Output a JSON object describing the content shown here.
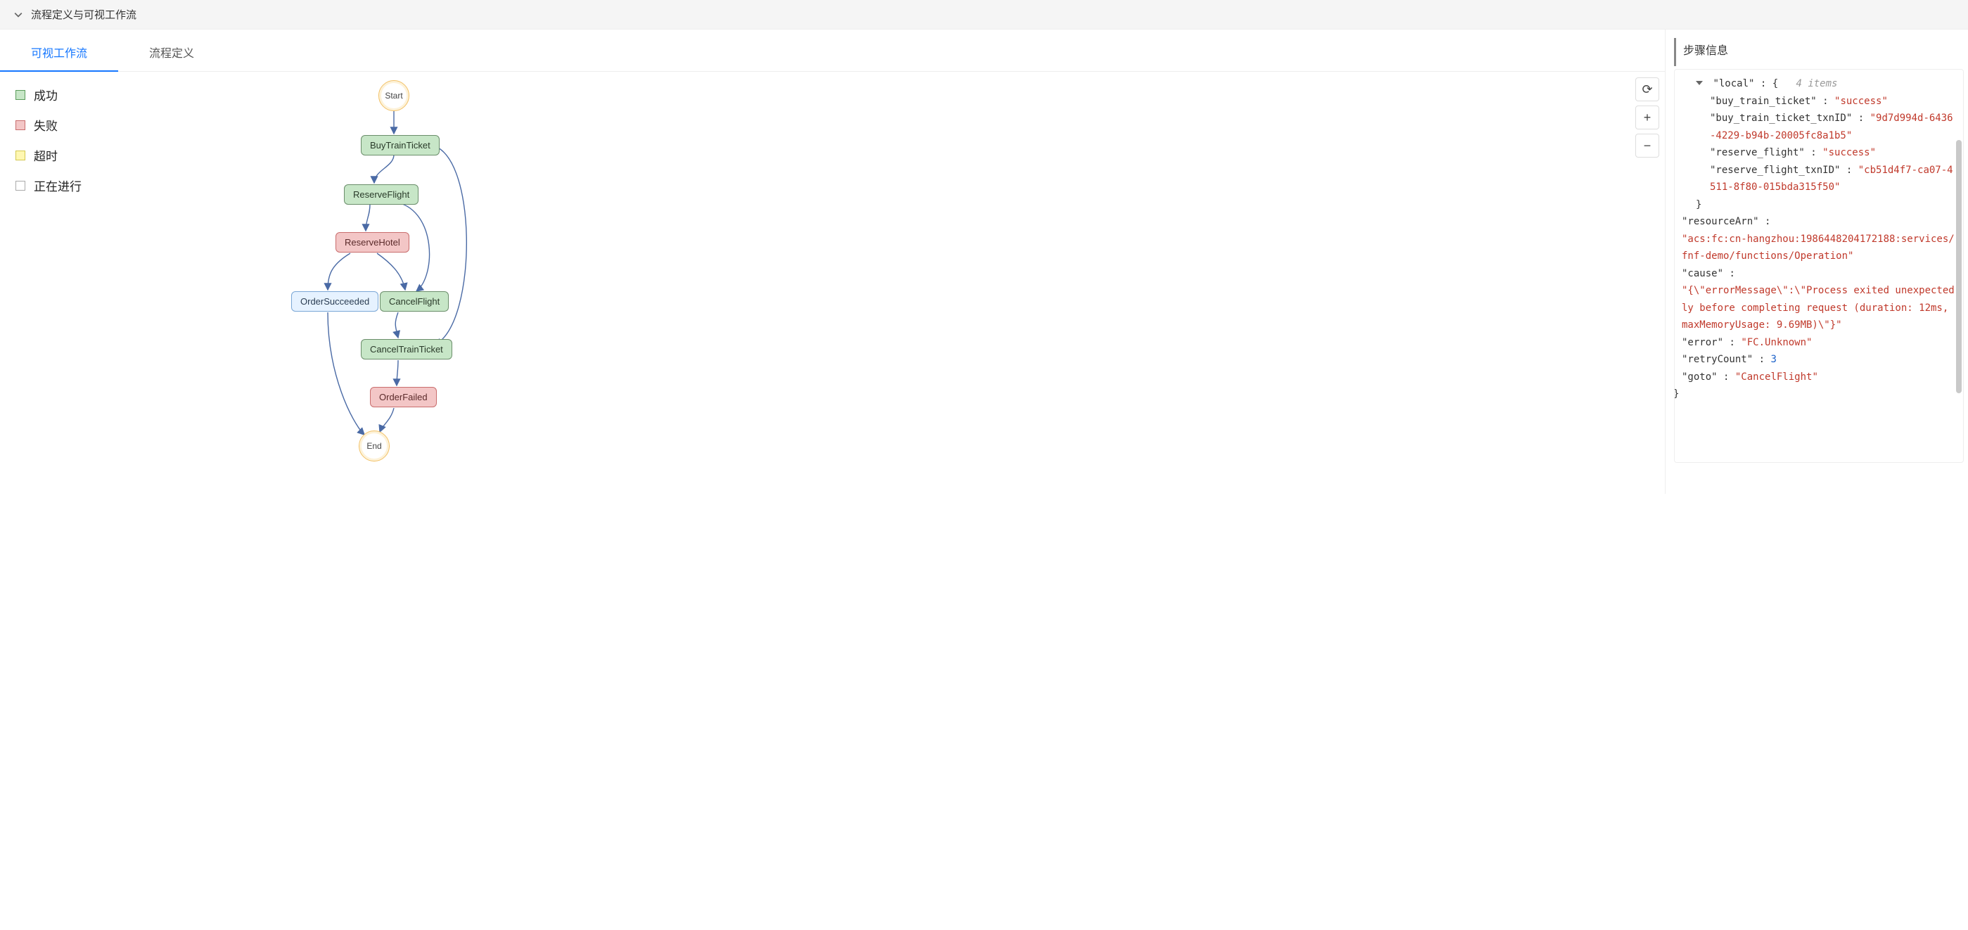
{
  "header": {
    "title": "流程定义与可视工作流"
  },
  "tabs": {
    "visual": "可视工作流",
    "definition": "流程定义"
  },
  "legend": {
    "success": "成功",
    "fail": "失败",
    "timeout": "超时",
    "running": "正在进行"
  },
  "nodes": {
    "start": "Start",
    "buy_train_ticket": "BuyTrainTicket",
    "reserve_flight": "ReserveFlight",
    "reserve_hotel": "ReserveHotel",
    "order_succeeded": "OrderSucceeded",
    "cancel_flight": "CancelFlight",
    "cancel_train_ticket": "CancelTrainTicket",
    "order_failed": "OrderFailed",
    "end": "End"
  },
  "canvas_buttons": {
    "refresh": "⟳",
    "zoom_in": "+",
    "zoom_out": "−"
  },
  "right": {
    "title": "步骤信息",
    "json": {
      "local_key": "\"local\"",
      "local_colon_brace": " : {",
      "local_items_note": "4 items",
      "btt_key": "\"buy_train_ticket\"",
      "btt_val": "\"success\"",
      "btt_tx_key": "\"buy_train_ticket_txnID\"",
      "btt_tx_val": "\"9d7d994d-6436-4229-b94b-20005fc8a1b5\"",
      "rf_key": "\"reserve_flight\"",
      "rf_val": "\"success\"",
      "rf_tx_key": "\"reserve_flight_txnID\"",
      "rf_tx_val": "\"cb51d4f7-ca07-4511-8f80-015bda315f50\"",
      "close_local": "}",
      "res_key": "\"resourceArn\"",
      "res_val": "\"acs:fc:cn-hangzhou:1986448204172188:services/fnf-demo/functions/Operation\"",
      "cause_key": "\"cause\"",
      "cause_val": "\"{\\\"errorMessage\\\":\\\"Process exited unexpectedly before completing request (duration: 12ms, maxMemoryUsage: 9.69MB)\\\"}\"",
      "error_key": "\"error\"",
      "error_val": "\"FC.Unknown\"",
      "retry_key": "\"retryCount\"",
      "retry_val": "3",
      "goto_key": "\"goto\"",
      "goto_val": "\"CancelFlight\"",
      "close_root": "}"
    }
  },
  "chart_data": {
    "type": "diagram-workflow",
    "nodes": [
      {
        "id": "Start",
        "status": "start"
      },
      {
        "id": "BuyTrainTicket",
        "status": "success"
      },
      {
        "id": "ReserveFlight",
        "status": "success"
      },
      {
        "id": "ReserveHotel",
        "status": "fail"
      },
      {
        "id": "OrderSucceeded",
        "status": "neutral"
      },
      {
        "id": "CancelFlight",
        "status": "success"
      },
      {
        "id": "CancelTrainTicket",
        "status": "success"
      },
      {
        "id": "OrderFailed",
        "status": "fail"
      },
      {
        "id": "End",
        "status": "end"
      }
    ],
    "edges": [
      [
        "Start",
        "BuyTrainTicket"
      ],
      [
        "BuyTrainTicket",
        "ReserveFlight"
      ],
      [
        "BuyTrainTicket",
        "CancelTrainTicket"
      ],
      [
        "ReserveFlight",
        "ReserveHotel"
      ],
      [
        "ReserveFlight",
        "CancelFlight"
      ],
      [
        "ReserveHotel",
        "OrderSucceeded"
      ],
      [
        "ReserveHotel",
        "CancelFlight"
      ],
      [
        "CancelFlight",
        "CancelTrainTicket"
      ],
      [
        "CancelTrainTicket",
        "OrderFailed"
      ],
      [
        "OrderSucceeded",
        "End"
      ],
      [
        "OrderFailed",
        "End"
      ]
    ]
  }
}
